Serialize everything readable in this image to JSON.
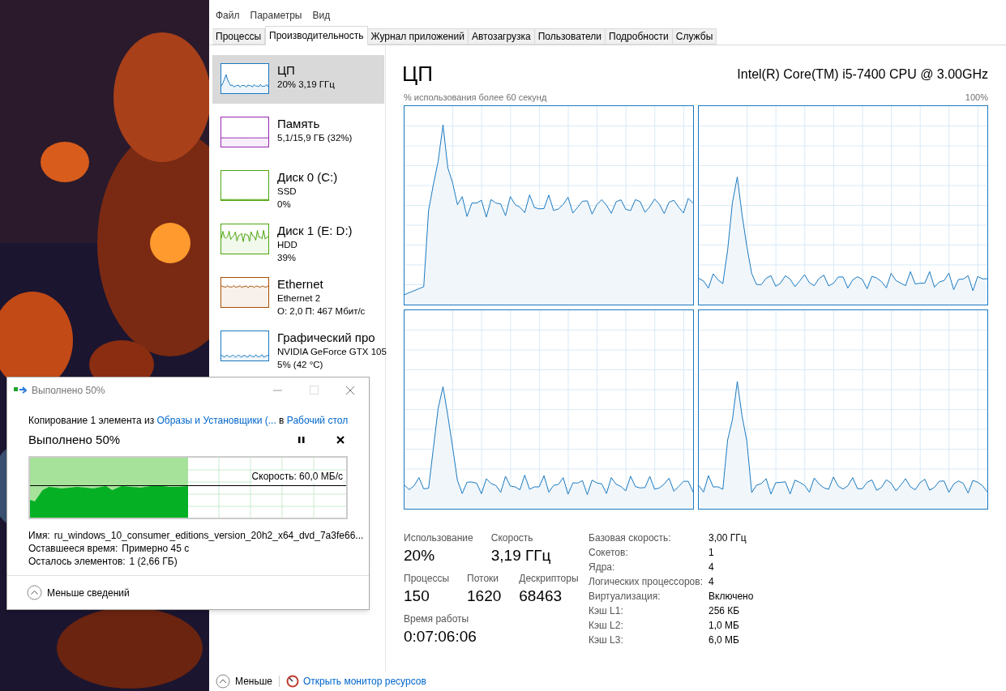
{
  "menu": [
    "Файл",
    "Параметры",
    "Вид"
  ],
  "tabs": [
    {
      "label": "Процессы",
      "selected": false
    },
    {
      "label": "Производительность",
      "selected": true
    },
    {
      "label": "Журнал приложений",
      "selected": false
    },
    {
      "label": "Автозагрузка",
      "selected": false
    },
    {
      "label": "Пользователи",
      "selected": false
    },
    {
      "label": "Подробности",
      "selected": false
    },
    {
      "label": "Службы",
      "selected": false
    }
  ],
  "sidebar": {
    "items": [
      {
        "name": "ЦП",
        "lines": [
          "20% 3,19 ГГц"
        ],
        "color": "#1979c1",
        "selected": true
      },
      {
        "name": "Память",
        "lines": [
          "5,1/15,9 ГБ (32%)"
        ],
        "color": "#9528b4",
        "selected": false
      },
      {
        "name": "Диск 0 (C:)",
        "lines": [
          "SSD",
          "0%"
        ],
        "color": "#4da60c",
        "selected": false
      },
      {
        "name": "Диск 1 (E: D:)",
        "lines": [
          "HDD",
          "39%"
        ],
        "color": "#4da60c",
        "selected": false
      },
      {
        "name": "Ethernet",
        "lines": [
          "Ethernet 2",
          "О: 2,0 П: 467 Мбит/с"
        ],
        "color": "#a74f01",
        "selected": false
      },
      {
        "name": "Графический про",
        "lines": [
          "NVIDIA GeForce GTX 105",
          "5% (42 °C)"
        ],
        "color": "#1979c1",
        "selected": false
      }
    ]
  },
  "header": {
    "title": "ЦП",
    "cpu_model": "Intel(R) Core(TM) i5-7400 CPU @ 3.00GHz"
  },
  "graph": {
    "caption": "% использования более 60 секунд",
    "max_label": "100%"
  },
  "stats": [
    {
      "label": "Использование",
      "value": "20%"
    },
    {
      "label": "Скорость",
      "value": "3,19 ГГц"
    },
    {
      "label": "Процессы",
      "value": "150"
    },
    {
      "label": "Потоки",
      "value": "1620"
    },
    {
      "label": "Дескрипторы",
      "value": "68463"
    },
    {
      "label": "Время работы",
      "value": "0:07:06:06"
    }
  ],
  "specs": [
    {
      "label": "Базовая скорость:",
      "value": "3,00 ГГц"
    },
    {
      "label": "Сокетов:",
      "value": "1"
    },
    {
      "label": "Ядра:",
      "value": "4"
    },
    {
      "label": "Логических процессоров:",
      "value": "4"
    },
    {
      "label": "Виртуализация:",
      "value": "Включено"
    },
    {
      "label": "Кэш L1:",
      "value": "256 КБ"
    },
    {
      "label": "Кэш L2:",
      "value": "1,0 МБ"
    },
    {
      "label": "Кэш L3:",
      "value": "6,0 МБ"
    }
  ],
  "footer": {
    "less": "Меньше",
    "link": "Открыть монитор ресурсов"
  },
  "copy_dialog": {
    "title": "Выполнено 50%",
    "line_prefix": "Копирование 1 элемента из",
    "source": "Образы и Установщики (...",
    "line_mid": "в",
    "target": "Рабочий стол",
    "progress_title": "Выполнено 50%",
    "level": 0.5,
    "speed": "Скорость: 60,0 МБ/с",
    "details": [
      {
        "label": "Имя:",
        "value": "ru_windows_10_consumer_editions_version_20h2_x64_dvd_7a3fe66..."
      },
      {
        "label": "Оставшееся время:",
        "value": "Примерно 45 с"
      },
      {
        "label": "Осталось элементов:",
        "value": "1 (2,66 ГБ)"
      }
    ],
    "less_details": "Меньше сведений"
  }
}
